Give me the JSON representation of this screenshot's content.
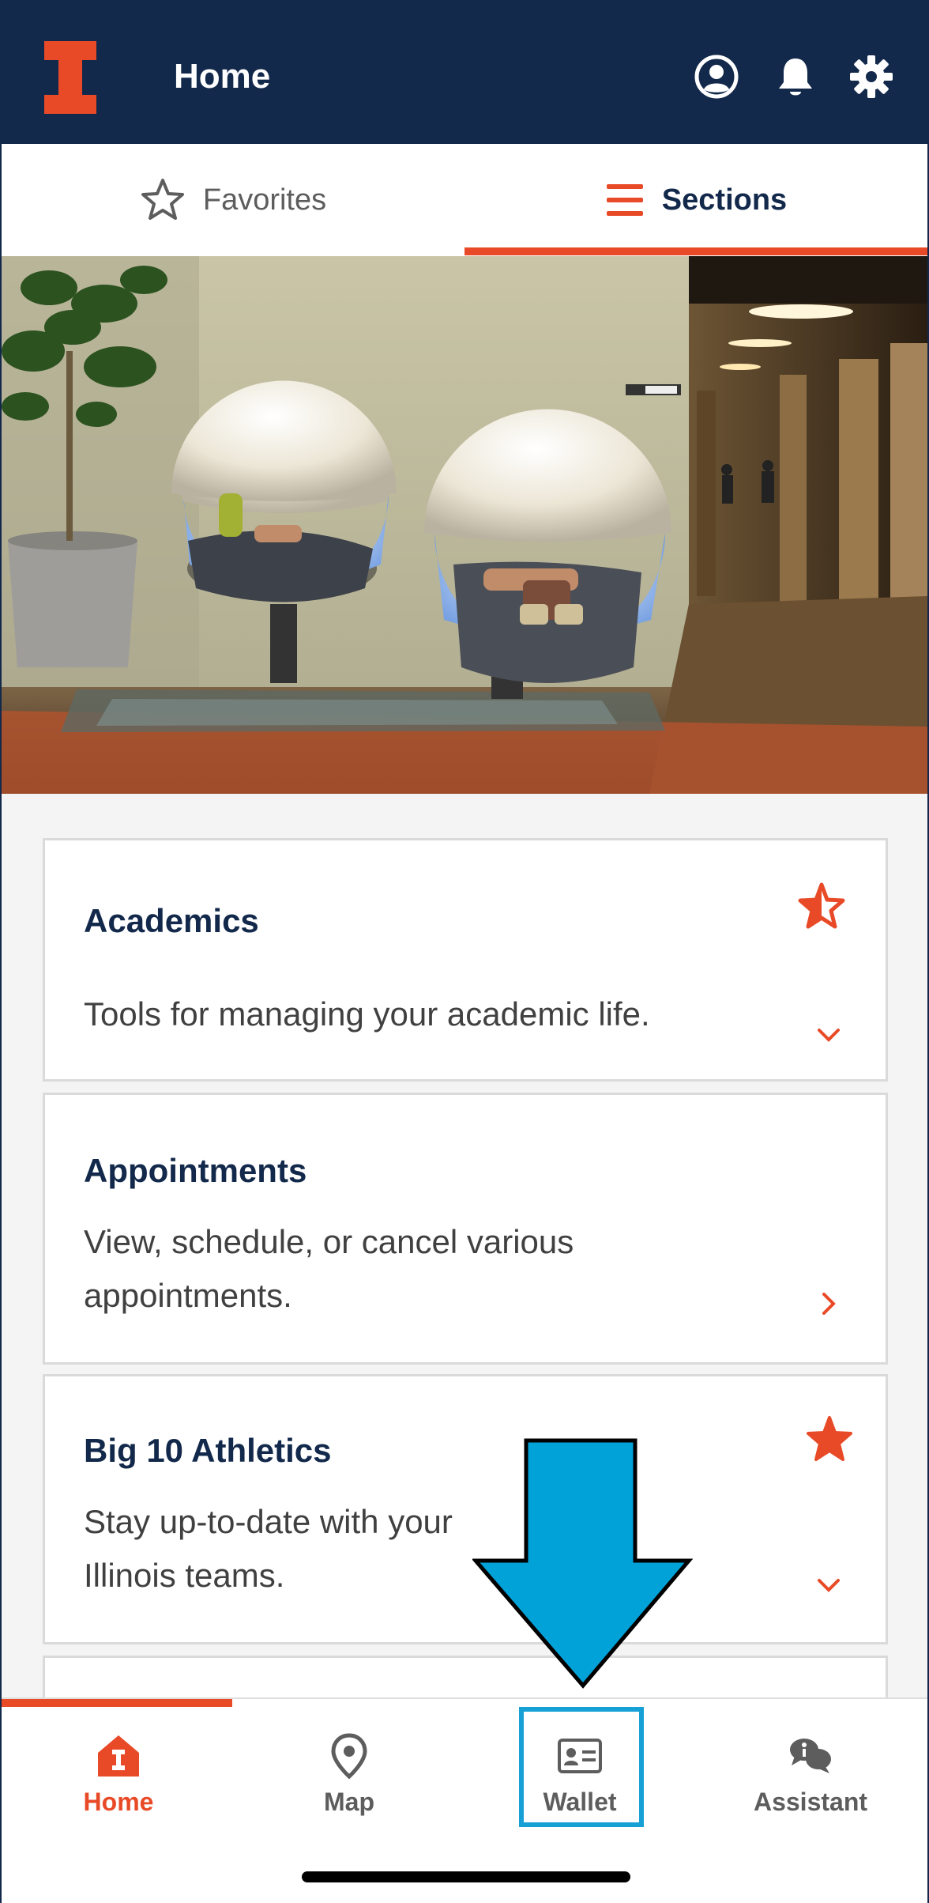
{
  "header": {
    "title": "Home"
  },
  "tabs": [
    {
      "label": "Favorites",
      "icon": "star-outline-icon"
    },
    {
      "label": "Sections",
      "icon": "hamburger-icon",
      "selected": true
    }
  ],
  "cards": [
    {
      "title": "Academics",
      "description": "Tools for managing your academic life.",
      "favorite": "half",
      "chevron": "down"
    },
    {
      "title": "Appointments",
      "description_lines": [
        "View, schedule, or cancel various",
        "appointments."
      ],
      "chevron": "right"
    },
    {
      "title": "Big 10 Athletics",
      "description_lines": [
        "Stay up-to-date with your",
        "Illinois teams."
      ],
      "favorite": "full",
      "chevron": "down"
    }
  ],
  "bottom_nav": [
    {
      "label": "Home",
      "icon": "home-icon",
      "selected": true
    },
    {
      "label": "Map",
      "icon": "map-pin-icon"
    },
    {
      "label": "Wallet",
      "icon": "id-card-icon",
      "highlighted": true
    },
    {
      "label": "Assistant",
      "icon": "chat-bubbles-icon"
    }
  ],
  "colors": {
    "navy": "#13294b",
    "orange": "#e84a27",
    "highlight_blue": "#16a0d5",
    "arrow_blue": "#00a2d8"
  }
}
